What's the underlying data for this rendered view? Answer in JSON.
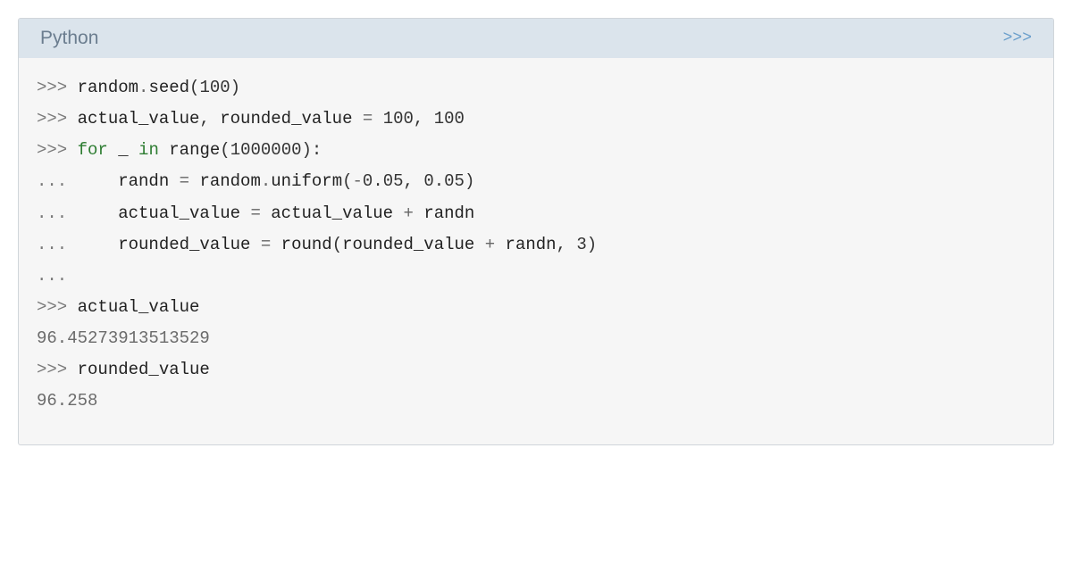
{
  "header": {
    "title": "Python",
    "toggle": ">>>"
  },
  "lines": {
    "l1_prompt": ">>> ",
    "l1_code": {
      "a": "random",
      "b": ".",
      "c": "seed",
      "d": "(",
      "e": "100",
      "f": ")"
    },
    "l2_prompt": ">>> ",
    "l2_code": {
      "a": "actual_value",
      "b": ",",
      "sp1": " ",
      "c": "rounded_value",
      "sp2": " ",
      "d": "=",
      "sp3": " ",
      "e": "100",
      "f": ",",
      "sp4": " ",
      "g": "100"
    },
    "l3_blank": "",
    "l4_prompt": ">>> ",
    "l4_code": {
      "a": "for",
      "sp1": " ",
      "b": "_",
      "sp2": " ",
      "c": "in",
      "sp3": " ",
      "d": "range",
      "e": "(",
      "f": "1000000",
      "g": "):"
    },
    "l5_prompt": "... ",
    "l5_code": {
      "indent": "    ",
      "a": "randn",
      "sp1": " ",
      "b": "=",
      "sp2": " ",
      "c": "random",
      "d": ".",
      "e": "uniform",
      "f": "(",
      "g": "-",
      "h": "0.05",
      "i": ",",
      "sp3": " ",
      "j": "0.05",
      "k": ")"
    },
    "l6_prompt": "... ",
    "l6_code": {
      "indent": "    ",
      "a": "actual_value",
      "sp1": " ",
      "b": "=",
      "sp2": " ",
      "c": "actual_value",
      "sp3": " ",
      "d": "+",
      "sp4": " ",
      "e": "randn"
    },
    "l7_prompt": "... ",
    "l7_code": {
      "indent": "    ",
      "a": "rounded_value",
      "sp1": " ",
      "b": "=",
      "sp2": " ",
      "c": "round",
      "d": "(",
      "e": "rounded_value",
      "sp3": " ",
      "f": "+",
      "sp4": " ",
      "g": "randn",
      "h": ",",
      "sp5": " ",
      "i": "3",
      "j": ")"
    },
    "l8_prompt": "...",
    "l9_blank": "",
    "l10_prompt": ">>> ",
    "l10_code": "actual_value",
    "l11_output": "96.45273913513529",
    "l12_blank": "",
    "l13_prompt": ">>> ",
    "l13_code": "rounded_value",
    "l14_output": "96.258"
  }
}
